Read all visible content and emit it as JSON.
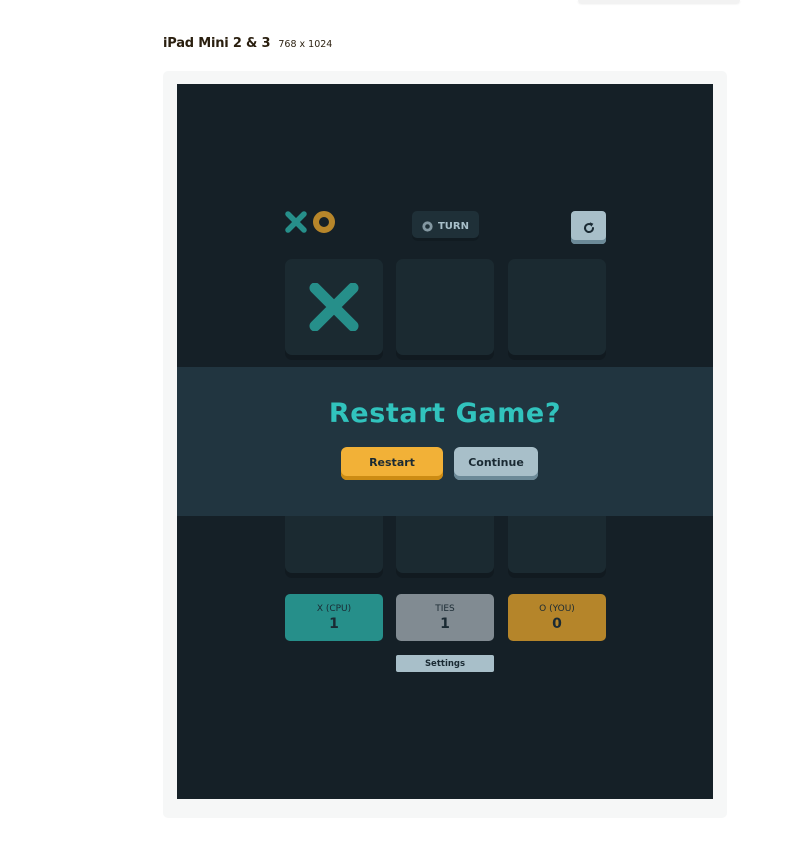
{
  "device": {
    "name": "iPad Mini 2 & 3",
    "dimensions": "768 x 1024"
  },
  "game": {
    "turn_label": "TURN",
    "turn_icon": "o-mark-icon",
    "board": [
      "X",
      "",
      "",
      "",
      "",
      "",
      "",
      "",
      ""
    ],
    "scores": [
      {
        "label": "X (CPU)",
        "value": "1",
        "color": "#31c3bd"
      },
      {
        "label": "TIES",
        "value": "1",
        "color": "#a8bfc9"
      },
      {
        "label": "O (YOU)",
        "value": "0",
        "color": "#f2b137"
      }
    ],
    "settings_label": "Settings"
  },
  "modal": {
    "title": "Restart Game?",
    "restart_label": "Restart",
    "continue_label": "Continue"
  },
  "colors": {
    "background": "#152027",
    "x_color": "#31c3bd",
    "o_color": "#f2b137",
    "silver": "#a8bfc9"
  }
}
